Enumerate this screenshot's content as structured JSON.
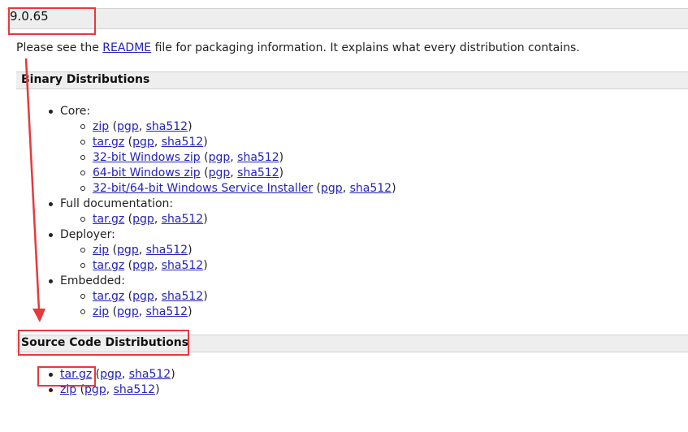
{
  "version": "9.0.65",
  "intro": {
    "before": "Please see the ",
    "link": "README",
    "after": " file for packaging information. It explains what every distribution contains."
  },
  "binary": {
    "title": "Binary Distributions",
    "core_label": "Core:",
    "core": [
      {
        "name": "zip",
        "sig1": "pgp",
        "sig2": "sha512"
      },
      {
        "name": "tar.gz",
        "sig1": "pgp",
        "sig2": "sha512"
      },
      {
        "name": "32-bit Windows zip",
        "sig1": "pgp",
        "sig2": "sha512"
      },
      {
        "name": "64-bit Windows zip",
        "sig1": "pgp",
        "sig2": "sha512"
      },
      {
        "name": "32-bit/64-bit Windows Service Installer",
        "sig1": "pgp",
        "sig2": "sha512"
      }
    ],
    "fulldoc_label": "Full documentation:",
    "fulldoc": [
      {
        "name": "tar.gz",
        "sig1": "pgp",
        "sig2": "sha512"
      }
    ],
    "deployer_label": "Deployer:",
    "deployer": [
      {
        "name": "zip",
        "sig1": "pgp",
        "sig2": "sha512"
      },
      {
        "name": "tar.gz",
        "sig1": "pgp",
        "sig2": "sha512"
      }
    ],
    "embedded_label": "Embedded:",
    "embedded": [
      {
        "name": "tar.gz",
        "sig1": "pgp",
        "sig2": "sha512"
      },
      {
        "name": "zip",
        "sig1": "pgp",
        "sig2": "sha512"
      }
    ]
  },
  "source": {
    "title": "Source Code Distributions",
    "items": [
      {
        "name": "tar.gz",
        "sig1": "pgp",
        "sig2": "sha512"
      },
      {
        "name": "zip",
        "sig1": "pgp",
        "sig2": "sha512"
      }
    ]
  },
  "annotation_color": "#e8383b"
}
